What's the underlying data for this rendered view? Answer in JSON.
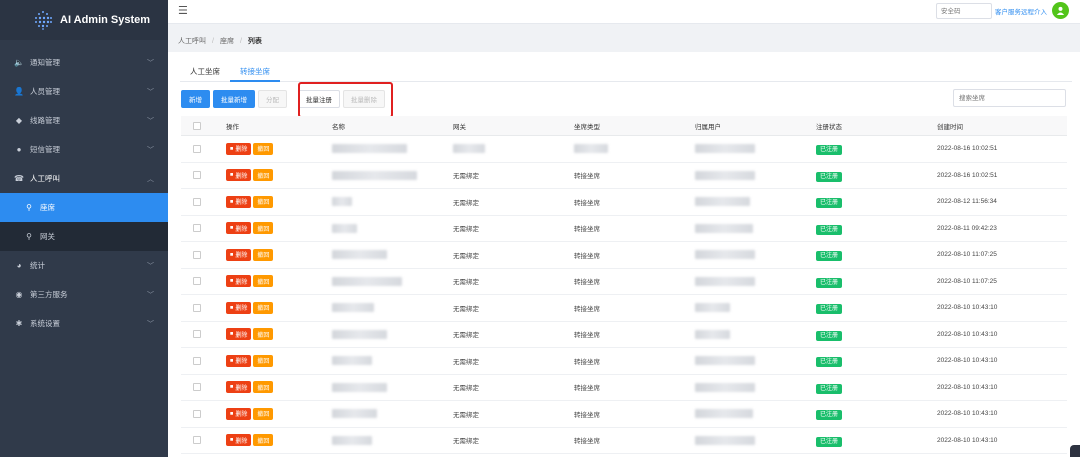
{
  "app": {
    "title": "AI Admin System"
  },
  "sidebar": {
    "items": [
      {
        "label": "通知管理",
        "icon": "speaker-icon"
      },
      {
        "label": "人员管理",
        "icon": "user-icon"
      },
      {
        "label": "线路管理",
        "icon": "route-icon"
      },
      {
        "label": "短信管理",
        "icon": "message-icon"
      },
      {
        "label": "人工呼叫",
        "icon": "phone-icon",
        "open": true,
        "children": [
          {
            "label": "座席",
            "active": true
          },
          {
            "label": "网关"
          }
        ]
      },
      {
        "label": "统计",
        "icon": "pie-chart-icon"
      },
      {
        "label": "第三方服务",
        "icon": "cat-icon"
      },
      {
        "label": "系统设置",
        "icon": "gear-icon"
      }
    ]
  },
  "topbar": {
    "safe_code_placeholder": "安全码",
    "service_link": "客户服务远程介入"
  },
  "breadcrumb": {
    "level1": "人工呼叫",
    "level2": "座席",
    "current": "列表"
  },
  "tabs": [
    {
      "label": "人工坐席"
    },
    {
      "label": "转接坐席",
      "active": true
    }
  ],
  "toolbar": {
    "add": "新增",
    "batch_add": "批量新增",
    "assign": "分配",
    "batch_register": "批量注册",
    "batch_delete": "批量删除",
    "search_placeholder": "搜索坐席"
  },
  "table": {
    "headers": {
      "ops": "操作",
      "name": "名称",
      "gateway": "网关",
      "type": "坐席类型",
      "owner": "归属用户",
      "status": "注册状态",
      "created": "创建时间"
    },
    "delete_label": "删除",
    "revoke_label": "撤回",
    "rows": [
      {
        "gateway": "",
        "type": "",
        "status": "已注册",
        "created": "2022-08-16 10:02:51"
      },
      {
        "gateway": "无需绑定",
        "type": "转接坐席",
        "status": "已注册",
        "created": "2022-08-16 10:02:51"
      },
      {
        "gateway": "无需绑定",
        "type": "转接坐席",
        "status": "已注册",
        "created": "2022-08-12 11:56:34"
      },
      {
        "gateway": "无需绑定",
        "type": "转接坐席",
        "status": "已注册",
        "created": "2022-08-11 09:42:23"
      },
      {
        "gateway": "无需绑定",
        "type": "转接坐席",
        "status": "已注册",
        "created": "2022-08-10 11:07:25"
      },
      {
        "gateway": "无需绑定",
        "type": "转接坐席",
        "status": "已注册",
        "created": "2022-08-10 11:07:25"
      },
      {
        "gateway": "无需绑定",
        "type": "转接坐席",
        "status": "已注册",
        "created": "2022-08-10 10:43:10"
      },
      {
        "gateway": "无需绑定",
        "type": "转接坐席",
        "status": "已注册",
        "created": "2022-08-10 10:43:10"
      },
      {
        "gateway": "无需绑定",
        "type": "转接坐席",
        "status": "已注册",
        "created": "2022-08-10 10:43:10"
      },
      {
        "gateway": "无需绑定",
        "type": "转接坐席",
        "status": "已注册",
        "created": "2022-08-10 10:43:10"
      },
      {
        "gateway": "无需绑定",
        "type": "转接坐席",
        "status": "已注册",
        "created": "2022-08-10 10:43:10"
      },
      {
        "gateway": "无需绑定",
        "type": "转接坐席",
        "status": "已注册",
        "created": "2022-08-10 10:43:10"
      }
    ]
  },
  "colors": {
    "sidebar_bg": "#303a4a",
    "accent": "#2d8cf0",
    "danger": "#ed4014",
    "warning": "#ff9900",
    "success": "#19be6b",
    "annotation": "#e02020"
  }
}
